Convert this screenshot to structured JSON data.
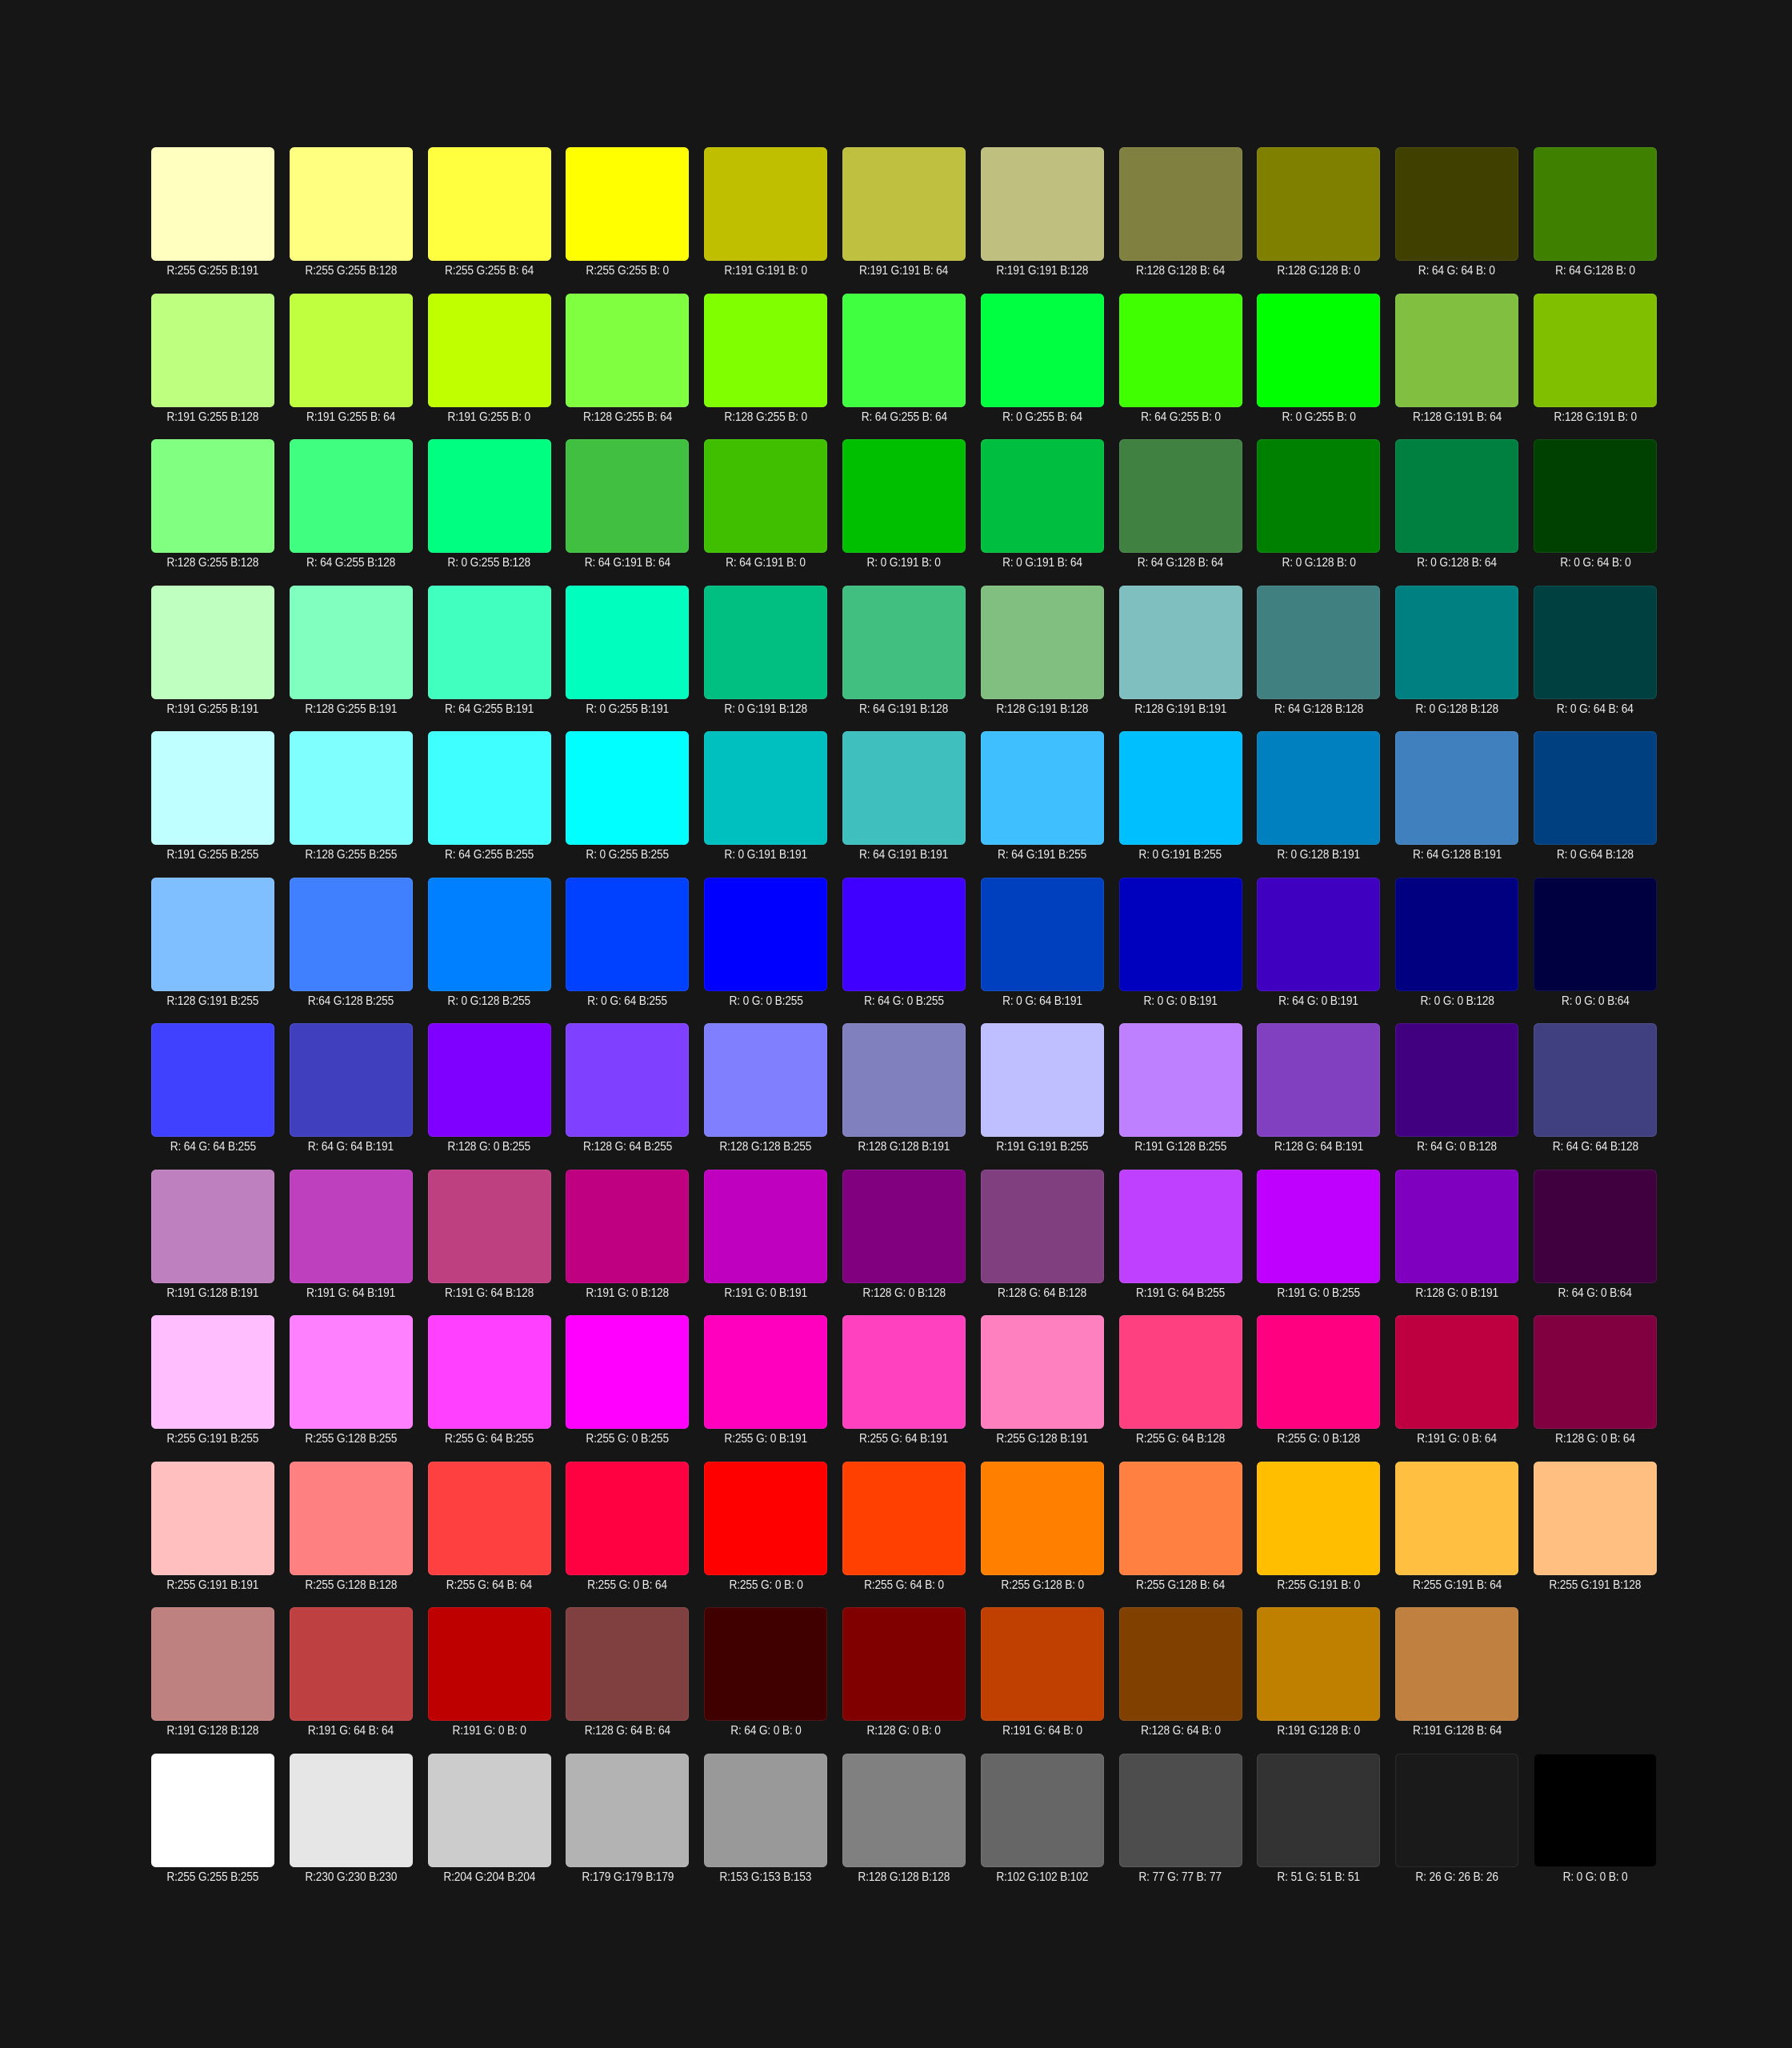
{
  "rows": [
    [
      {
        "color": "#ffffbf",
        "label": "R:255 G:255 B:191"
      },
      {
        "color": "#ffff80",
        "label": "R:255 G:255 B:128"
      },
      {
        "color": "#ffff40",
        "label": "R:255 G:255 B: 64"
      },
      {
        "color": "#ffff00",
        "label": "R:255 G:255 B: 0"
      },
      {
        "color": "#bfbf00",
        "label": "R:191 G:191 B: 0"
      },
      {
        "color": "#bfbf40",
        "label": "R:191 G:191 B: 64"
      },
      {
        "color": "#bfbf80",
        "label": "R:191 G:191 B:128"
      },
      {
        "color": "#808040",
        "label": "R:128 G:128 B: 64"
      },
      {
        "color": "#808000",
        "label": "R:128 G:128 B: 0"
      },
      {
        "color": "#404000",
        "label": "R: 64 G: 64 B: 0"
      },
      {
        "color": "#408000",
        "label": "R: 64 G:128 B: 0"
      }
    ],
    [
      {
        "color": "#bfff80",
        "label": "R:191 G:255 B:128"
      },
      {
        "color": "#bfff40",
        "label": "R:191 G:255 B: 64"
      },
      {
        "color": "#bfff00",
        "label": "R:191 G:255 B: 0"
      },
      {
        "color": "#80ff40",
        "label": "R:128 G:255 B: 64"
      },
      {
        "color": "#80ff00",
        "label": "R:128 G:255 B: 0"
      },
      {
        "color": "#40ff40",
        "label": "R: 64 G:255 B: 64"
      },
      {
        "color": "#00ff40",
        "label": "R: 0 G:255 B: 64"
      },
      {
        "color": "#40ff00",
        "label": "R: 64 G:255 B: 0"
      },
      {
        "color": "#00ff00",
        "label": "R: 0 G:255 B: 0"
      },
      {
        "color": "#80bf40",
        "label": "R:128 G:191 B: 64"
      },
      {
        "color": "#80bf00",
        "label": "R:128 G:191 B: 0"
      }
    ],
    [
      {
        "color": "#80ff80",
        "label": "R:128 G:255 B:128"
      },
      {
        "color": "#40ff80",
        "label": "R: 64 G:255 B:128"
      },
      {
        "color": "#00ff80",
        "label": "R: 0 G:255 B:128"
      },
      {
        "color": "#40bf40",
        "label": "R: 64 G:191 B: 64"
      },
      {
        "color": "#40bf00",
        "label": "R: 64 G:191 B: 0"
      },
      {
        "color": "#00bf00",
        "label": "R: 0 G:191 B: 0"
      },
      {
        "color": "#00bf40",
        "label": "R: 0 G:191 B: 64"
      },
      {
        "color": "#408040",
        "label": "R: 64 G:128 B: 64"
      },
      {
        "color": "#008000",
        "label": "R: 0 G:128 B: 0"
      },
      {
        "color": "#008040",
        "label": "R: 0 G:128 B: 64"
      },
      {
        "color": "#004000",
        "label": "R: 0 G: 64 B: 0"
      }
    ],
    [
      {
        "color": "#bfffbf",
        "label": "R:191 G:255 B:191"
      },
      {
        "color": "#80ffbf",
        "label": "R:128 G:255 B:191"
      },
      {
        "color": "#40ffbf",
        "label": "R: 64 G:255 B:191"
      },
      {
        "color": "#00ffbf",
        "label": "R: 0 G:255 B:191"
      },
      {
        "color": "#00bf80",
        "label": "R: 0 G:191 B:128"
      },
      {
        "color": "#40bf80",
        "label": "R: 64 G:191 B:128"
      },
      {
        "color": "#80bf80",
        "label": "R:128 G:191 B:128"
      },
      {
        "color": "#80bfbf",
        "label": "R:128 G:191 B:191"
      },
      {
        "color": "#408080",
        "label": "R: 64 G:128 B:128"
      },
      {
        "color": "#008080",
        "label": "R: 0 G:128 B:128"
      },
      {
        "color": "#004040",
        "label": "R: 0 G: 64 B: 64"
      }
    ],
    [
      {
        "color": "#bfffff",
        "label": "R:191 G:255 B:255"
      },
      {
        "color": "#80ffff",
        "label": "R:128 G:255 B:255"
      },
      {
        "color": "#40ffff",
        "label": "R: 64 G:255 B:255"
      },
      {
        "color": "#00ffff",
        "label": "R: 0 G:255 B:255"
      },
      {
        "color": "#00bfbf",
        "label": "R: 0 G:191 B:191"
      },
      {
        "color": "#40bfbf",
        "label": "R: 64 G:191 B:191"
      },
      {
        "color": "#40bfff",
        "label": "R: 64 G:191 B:255"
      },
      {
        "color": "#00bfff",
        "label": "R: 0 G:191 B:255"
      },
      {
        "color": "#0080bf",
        "label": "R: 0 G:128 B:191"
      },
      {
        "color": "#4080bf",
        "label": "R: 64 G:128 B:191"
      },
      {
        "color": "#004080",
        "label": "R: 0 G:64 B:128"
      }
    ],
    [
      {
        "color": "#80bfff",
        "label": "R:128 G:191 B:255"
      },
      {
        "color": "#4080ff",
        "label": "R:64 G:128 B:255"
      },
      {
        "color": "#0080ff",
        "label": "R: 0 G:128 B:255"
      },
      {
        "color": "#0040ff",
        "label": "R: 0 G: 64 B:255"
      },
      {
        "color": "#0000ff",
        "label": "R: 0 G: 0 B:255"
      },
      {
        "color": "#4000ff",
        "label": "R: 64 G: 0 B:255"
      },
      {
        "color": "#0040bf",
        "label": "R: 0 G: 64 B:191"
      },
      {
        "color": "#0000bf",
        "label": "R: 0 G: 0 B:191"
      },
      {
        "color": "#4000bf",
        "label": "R: 64 G: 0 B:191"
      },
      {
        "color": "#000080",
        "label": "R: 0 G: 0 B:128"
      },
      {
        "color": "#000040",
        "label": "R: 0 G: 0 B:64"
      }
    ],
    [
      {
        "color": "#4040ff",
        "label": "R: 64 G: 64 B:255"
      },
      {
        "color": "#4040bf",
        "label": "R: 64 G: 64 B:191"
      },
      {
        "color": "#8000ff",
        "label": "R:128 G: 0 B:255"
      },
      {
        "color": "#8040ff",
        "label": "R:128 G: 64 B:255"
      },
      {
        "color": "#8080ff",
        "label": "R:128 G:128 B:255"
      },
      {
        "color": "#8080bf",
        "label": "R:128 G:128 B:191"
      },
      {
        "color": "#bfbfff",
        "label": "R:191 G:191 B:255"
      },
      {
        "color": "#bf80ff",
        "label": "R:191 G:128 B:255"
      },
      {
        "color": "#8040bf",
        "label": "R:128 G: 64 B:191"
      },
      {
        "color": "#400080",
        "label": "R: 64 G: 0 B:128"
      },
      {
        "color": "#404080",
        "label": "R: 64 G: 64 B:128"
      }
    ],
    [
      {
        "color": "#bf80bf",
        "label": "R:191 G:128 B:191"
      },
      {
        "color": "#bf40bf",
        "label": "R:191 G: 64 B:191"
      },
      {
        "color": "#bf4080",
        "label": "R:191 G: 64 B:128"
      },
      {
        "color": "#bf0080",
        "label": "R:191 G: 0 B:128"
      },
      {
        "color": "#bf00bf",
        "label": "R:191 G: 0 B:191"
      },
      {
        "color": "#800080",
        "label": "R:128 G: 0 B:128"
      },
      {
        "color": "#804080",
        "label": "R:128 G: 64 B:128"
      },
      {
        "color": "#bf40ff",
        "label": "R:191 G: 64 B:255"
      },
      {
        "color": "#bf00ff",
        "label": "R:191 G: 0 B:255"
      },
      {
        "color": "#8000bf",
        "label": "R:128 G: 0 B:191"
      },
      {
        "color": "#400040",
        "label": "R: 64 G: 0 B:64"
      }
    ],
    [
      {
        "color": "#ffbfff",
        "label": "R:255 G:191 B:255"
      },
      {
        "color": "#ff80ff",
        "label": "R:255 G:128 B:255"
      },
      {
        "color": "#ff40ff",
        "label": "R:255 G: 64 B:255"
      },
      {
        "color": "#ff00ff",
        "label": "R:255 G: 0 B:255"
      },
      {
        "color": "#ff00bf",
        "label": "R:255 G: 0 B:191"
      },
      {
        "color": "#ff40bf",
        "label": "R:255 G: 64 B:191"
      },
      {
        "color": "#ff80bf",
        "label": "R:255 G:128 B:191"
      },
      {
        "color": "#ff4080",
        "label": "R:255 G: 64 B:128"
      },
      {
        "color": "#ff0080",
        "label": "R:255 G: 0 B:128"
      },
      {
        "color": "#bf0040",
        "label": "R:191 G: 0 B: 64"
      },
      {
        "color": "#800040",
        "label": "R:128 G: 0 B: 64"
      }
    ],
    [
      {
        "color": "#ffbfbf",
        "label": "R:255 G:191 B:191"
      },
      {
        "color": "#ff8080",
        "label": "R:255 G:128 B:128"
      },
      {
        "color": "#ff4040",
        "label": "R:255 G: 64 B: 64"
      },
      {
        "color": "#ff0040",
        "label": "R:255 G: 0 B: 64"
      },
      {
        "color": "#ff0000",
        "label": "R:255 G: 0 B: 0"
      },
      {
        "color": "#ff4000",
        "label": "R:255 G: 64 B: 0"
      },
      {
        "color": "#ff8000",
        "label": "R:255 G:128 B: 0"
      },
      {
        "color": "#ff8040",
        "label": "R:255 G:128 B: 64"
      },
      {
        "color": "#ffbf00",
        "label": "R:255 G:191 B: 0"
      },
      {
        "color": "#ffbf40",
        "label": "R:255 G:191 B: 64"
      },
      {
        "color": "#ffbf80",
        "label": "R:255 G:191 B:128"
      }
    ],
    [
      {
        "color": "#bf8080",
        "label": "R:191 G:128 B:128"
      },
      {
        "color": "#bf4040",
        "label": "R:191 G: 64 B: 64"
      },
      {
        "color": "#bf0000",
        "label": "R:191 G: 0 B: 0"
      },
      {
        "color": "#804040",
        "label": "R:128 G: 64 B: 64"
      },
      {
        "color": "#400000",
        "label": "R: 64 G: 0 B: 0"
      },
      {
        "color": "#800000",
        "label": "R:128 G: 0 B: 0"
      },
      {
        "color": "#bf4000",
        "label": "R:191 G: 64 B: 0"
      },
      {
        "color": "#804000",
        "label": "R:128 G: 64 B: 0"
      },
      {
        "color": "#bf8000",
        "label": "R:191 G:128 B: 0"
      },
      {
        "color": "#bf8040",
        "label": "R:191 G:128 B: 64"
      },
      {
        "color": "",
        "label": ""
      }
    ],
    [
      {
        "color": "#ffffff",
        "label": "R:255 G:255 B:255"
      },
      {
        "color": "#e6e6e6",
        "label": "R:230 G:230 B:230"
      },
      {
        "color": "#cccccc",
        "label": "R:204 G:204 B:204"
      },
      {
        "color": "#b3b3b3",
        "label": "R:179 G:179 B:179"
      },
      {
        "color": "#999999",
        "label": "R:153 G:153 B:153"
      },
      {
        "color": "#808080",
        "label": "R:128 G:128 B:128"
      },
      {
        "color": "#666666",
        "label": "R:102 G:102 B:102"
      },
      {
        "color": "#4d4d4d",
        "label": "R: 77 G: 77 B: 77"
      },
      {
        "color": "#333333",
        "label": "R: 51 G: 51 B: 51"
      },
      {
        "color": "#1a1a1a",
        "label": "R: 26 G: 26 B: 26"
      },
      {
        "color": "#000000",
        "label": "R: 0 G: 0 B: 0"
      }
    ]
  ]
}
